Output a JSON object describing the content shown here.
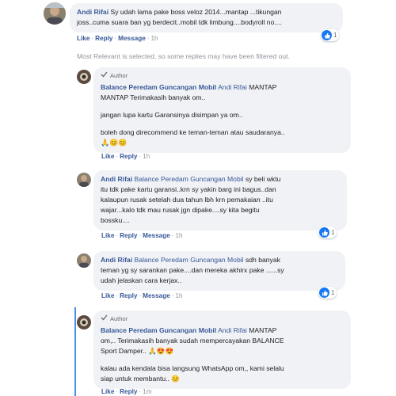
{
  "comment": {
    "name": "Andi Rifai",
    "text_lines": [
      "Sy udah lama pake boss veloz 2014...mantap ...tikungan",
      "joss..cuma suara ban yg berdecit..mobil tdk limbung....bodyroll no...."
    ],
    "actions": {
      "like": "Like",
      "reply": "Reply",
      "message": "Message",
      "time": "1h"
    },
    "reaction_count": "1"
  },
  "notice": "Most Relevant is selected, so some replies may have been filtered out.",
  "replies": [
    {
      "author_label": "Author",
      "name": "Balance Peredam Guncangan Mobil",
      "tag": "Andi Rifai",
      "lines": [
        "MANTAP",
        "MANTAP Terimakasih banyak om..",
        "",
        "jangan lupa kartu Garansinya disimpan ya om..",
        "",
        "boleh dong direcommend ke teman-teman atau saudaranya..",
        "🙏😊😊"
      ],
      "actions": {
        "like": "Like",
        "reply": "Reply",
        "time": "1h"
      }
    },
    {
      "name": "Andi Rifai",
      "tag": "Balance Peredam Guncangan Mobil",
      "lines": [
        "sy beli wktu",
        "itu tdk pake kartu garansi..krn sy yakin barg ini bagus..dan",
        "kalaupun rusak setelah dua tahun lbh krn pemakaian ..itu",
        "wajar...kalo tdk mau rusak jgn dipake....sy kita begitu",
        "bossku...."
      ],
      "actions": {
        "like": "Like",
        "reply": "Reply",
        "message": "Message",
        "time": "1h"
      },
      "reaction_count": "1"
    },
    {
      "name": "Andi Rifai",
      "tag": "Balance Peredam Guncangan Mobil",
      "lines": [
        "sdh banyak",
        "teman yg sy sarankan pake....dan mereka akhirx pake ......sy",
        "udah jelaskan cara kerjax.."
      ],
      "actions": {
        "like": "Like",
        "reply": "Reply",
        "message": "Message",
        "time": "1h"
      },
      "reaction_count": "1"
    },
    {
      "author_label": "Author",
      "name": "Balance Peredam Guncangan Mobil",
      "tag": "Andi Rifai",
      "lines": [
        "MANTAP",
        "om,.. Terimakasih banyak sudah mempercayakan BALANCE",
        "Sport Damper.. 🙏😍😍",
        "",
        "kalau ada kendala bisa langsung WhatsApp om,, kami selalu",
        "siap untuk membantu.. 😊"
      ],
      "actions": {
        "like": "Like",
        "reply": "Reply",
        "time": "1m"
      }
    }
  ],
  "colors": {
    "link": "#385898",
    "bubble": "#f0f2f5",
    "like_blue": "#1877f2",
    "thread": "#4a90e2"
  }
}
